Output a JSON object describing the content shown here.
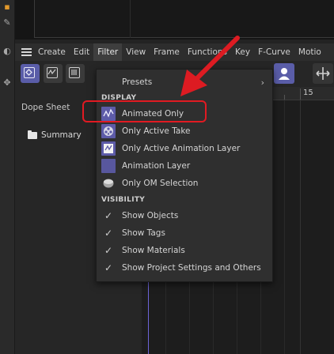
{
  "menubar": {
    "items": [
      "Create",
      "Edit",
      "Filter",
      "View",
      "Frame",
      "Functions",
      "Key",
      "F-Curve",
      "Motio"
    ]
  },
  "left_panel": {
    "title": "Dope Sheet",
    "summary": "Summary"
  },
  "timeline": {
    "frame_label": "15"
  },
  "filter_menu": {
    "presets": "Presets",
    "display_header": "DISPLAY",
    "display_items": [
      {
        "label": "Animated Only",
        "icon": "fcurve-icon"
      },
      {
        "label": "Only Active Take",
        "icon": "take-icon"
      },
      {
        "label": "Only Active Animation Layer",
        "icon": "animation-layer-active-icon"
      },
      {
        "label": "Animation Layer",
        "icon": "animation-layer-icon"
      },
      {
        "label": "Only OM Selection",
        "icon": "object-manager-icon"
      }
    ],
    "visibility_header": "VISIBILITY",
    "visibility_items": [
      {
        "label": "Show Objects",
        "checked": true
      },
      {
        "label": "Show Tags",
        "checked": true
      },
      {
        "label": "Show Materials",
        "checked": true
      },
      {
        "label": "Show Project Settings and Others",
        "checked": true
      }
    ]
  },
  "colors": {
    "accent": "#5a5da8",
    "highlight": "#e11a22",
    "playhead": "#6c63d8"
  }
}
